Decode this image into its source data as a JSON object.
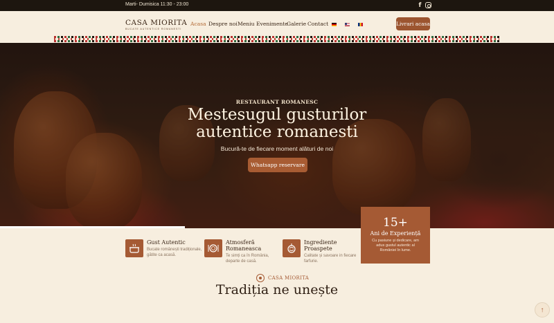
{
  "topbar": {
    "hours": "Marti- Dumisica 11:30 - 23:00",
    "facebook_icon": "facebook-icon",
    "instagram_icon": "instagram-icon"
  },
  "logo": {
    "name": "CASA MIORITA",
    "tagline": "BUCATE AUTENTICE ROMANESTI"
  },
  "nav": {
    "items": [
      {
        "label": "Acasa",
        "active": true
      },
      {
        "label": "Despre noi"
      },
      {
        "label": "Meniu"
      },
      {
        "label": "Evenimente"
      },
      {
        "label": "Galerie"
      },
      {
        "label": "Contact"
      }
    ],
    "languages": [
      "de-flag",
      "us-flag",
      "ro-flag"
    ],
    "cta": "Livrari acasa"
  },
  "hero": {
    "eyebrow": "RESTAURANT ROMANESC",
    "title": "Mestesugul gusturilor autentice romanesti",
    "subtitle": "Bucură-te de fiecare moment alături de noi",
    "button": "Whatsapp reservare"
  },
  "experience": {
    "number": "15+",
    "title": "Ani de Experiență",
    "text": "Cu pasiune și dedicare, am adus gustul autentic al României în lume."
  },
  "features": [
    {
      "icon": "pot-icon",
      "title": "Gust Autentic",
      "text": "Bucate românești tradiționale, gătite ca acasă."
    },
    {
      "icon": "plate-icon",
      "title": "Atmosferă Romaneasca",
      "text": "Te simți ca în România, departe de casă."
    },
    {
      "icon": "vegetables-icon",
      "title": "Ingrediente Proaspete",
      "text": "Calitate și savoare in fiecare farfurie."
    }
  ],
  "section": {
    "brand": "CASA MIORITA",
    "title": "Tradiția ne unește"
  },
  "colors": {
    "accent": "#a55a34",
    "background": "#f7eedf",
    "topbar": "#1d160f"
  }
}
